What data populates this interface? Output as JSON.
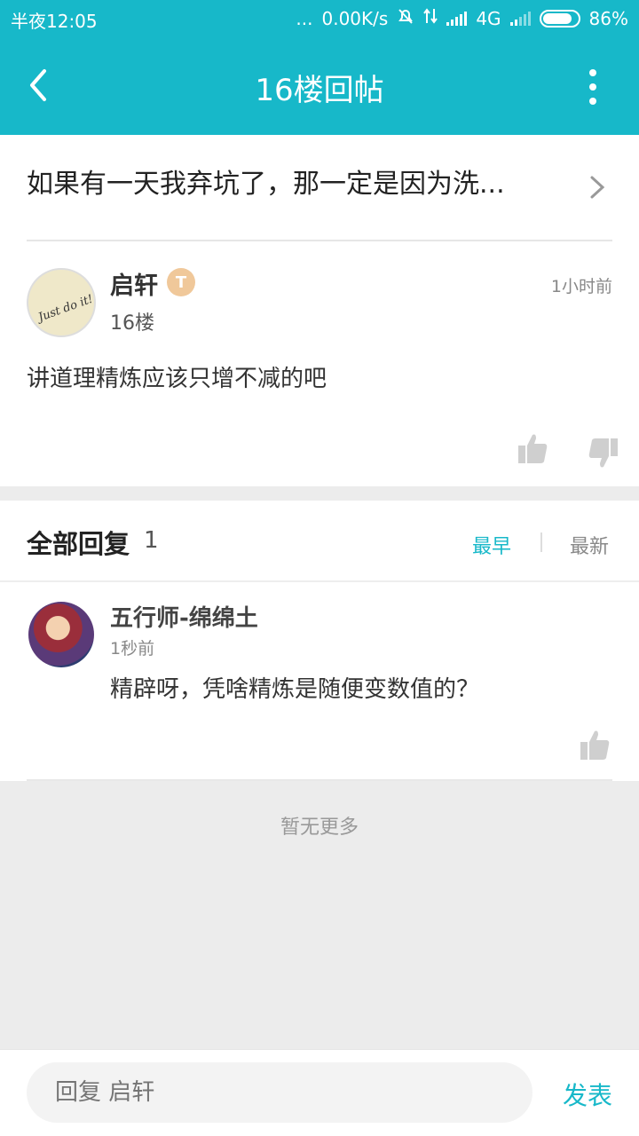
{
  "status": {
    "time": "半夜12:05",
    "dots": "...",
    "speed": "0.00K/s",
    "network": "4G",
    "battery": "86%",
    "battery_level": 0.86
  },
  "appbar": {
    "title": "16楼回帖"
  },
  "post": {
    "thread_title": "如果有一天我弃坑了，那一定是因为洗...",
    "author": "启轩",
    "badge": "T",
    "floor": "16楼",
    "time": "1小时前",
    "content": "讲道理精炼应该只增不减的吧",
    "avatar_text": "Just do it!"
  },
  "replies": {
    "header": "全部回复",
    "count": "1",
    "sort_early": "最早",
    "sort_new": "最新",
    "items": [
      {
        "name": "五行师-绵绵土",
        "time": "1秒前",
        "text": "精辟呀，凭啥精炼是随便变数值的？"
      }
    ]
  },
  "footer": {
    "no_more": "暂无更多"
  },
  "bottom": {
    "placeholder": "回复 启轩",
    "send": "发表"
  },
  "colors": {
    "accent": "#17b8c9",
    "background": "#ececec"
  }
}
